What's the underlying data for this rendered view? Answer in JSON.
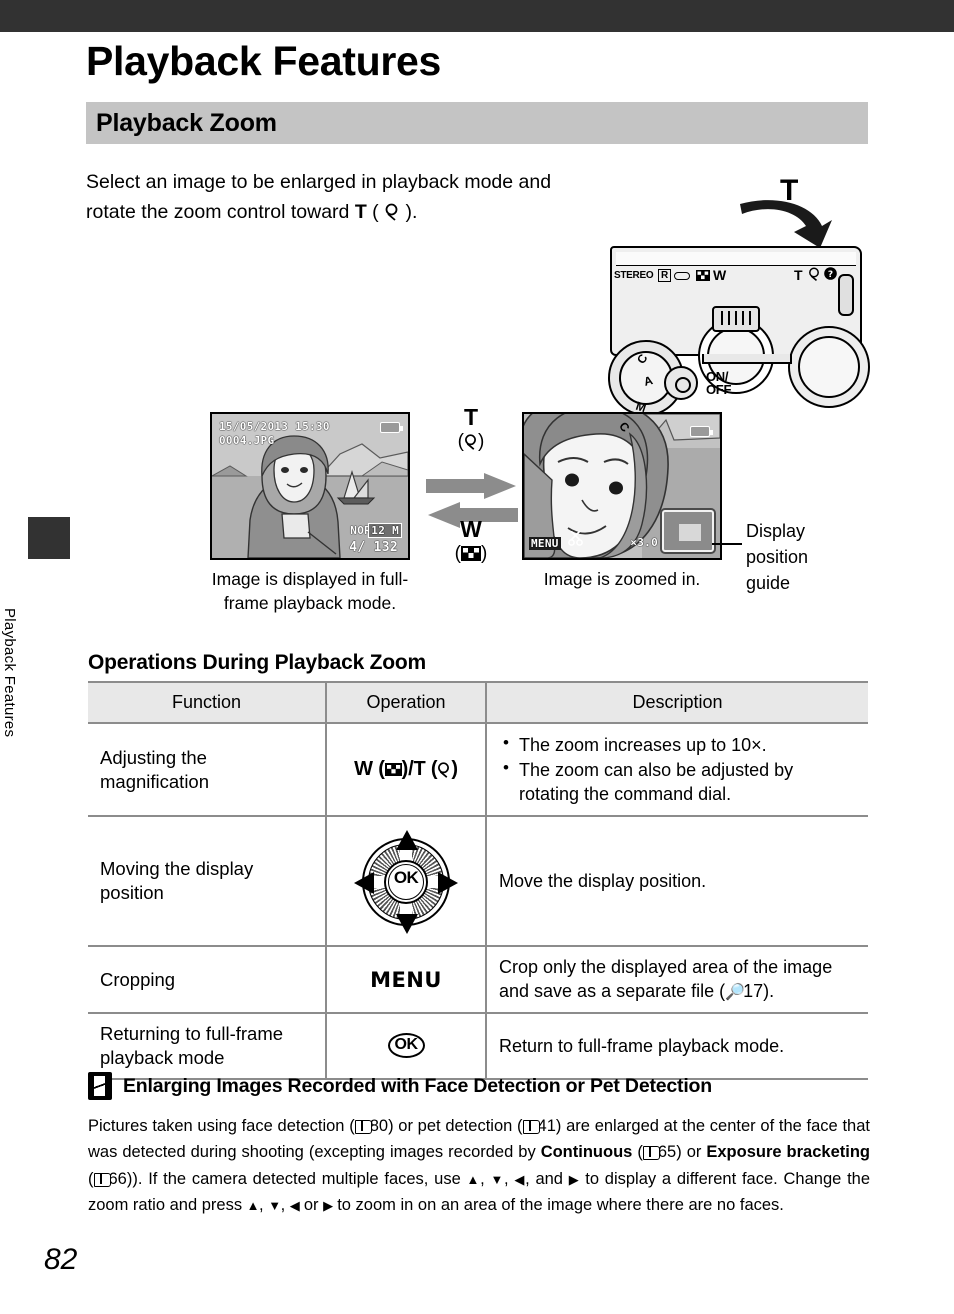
{
  "page": {
    "number": "82",
    "sidebar_vertical_label": "Playback Features",
    "title": "Playback Features",
    "section_band": "Playback Zoom"
  },
  "intro": {
    "line1": "Select an image to be enlarged in playback mode and",
    "line2_pre": "rotate the zoom control toward ",
    "line2_key": "T",
    "line2_post": " (",
    "line2_icon": "magnifier-icon",
    "line2_end": ").",
    "camera_label_T": "T"
  },
  "camera": {
    "labels": {
      "stereo": "STEREO",
      "r_mark": "R",
      "wide": "W",
      "tele": "T",
      "onoff": "ON/\nOFF",
      "mode_m": "M",
      "mode_a": "A",
      "mode_c": "C",
      "thumb_icon": "thumbnail-grid-icon",
      "magnifier_icon": "magnifier-icon",
      "help_icon": "help-question-icon"
    },
    "rotate_arrow": "curved-rotate-arrow-icon"
  },
  "diagram": {
    "lcd_full": {
      "datetime": "15/05/2013  15:30",
      "filename": "0004.JPG",
      "quality": "NORM",
      "size_badge": "12 M",
      "counter": "4/ 132"
    },
    "lcd_zoom": {
      "menu_key": "MENU",
      "crop_icon": "crop-scissors-icon",
      "zoom_ratio": "×3.0",
      "guide_icon": "display-position-guide-icon"
    },
    "tele_label": {
      "key": "T",
      "icon_text": "(Q)"
    },
    "wide_label": {
      "key": "W",
      "icon_text": "(⬚)"
    },
    "caption_left_l1": "Image is displayed in full-",
    "caption_left_l2": "frame playback mode.",
    "caption_right": "Image is zoomed in.",
    "guide_label_l1": "Display",
    "guide_label_l2": "position",
    "guide_label_l3": "guide"
  },
  "operations": {
    "heading": "Operations During Playback Zoom",
    "columns": [
      "Function",
      "Operation",
      "Description"
    ],
    "rows": [
      {
        "function": "Adjusting the\nmagnification",
        "operation_type": "wt-keys",
        "operation_w": "W",
        "operation_t": "T",
        "description_bullets": [
          "The zoom increases up to 10×.",
          "The zoom can also be adjusted by rotating the command dial."
        ]
      },
      {
        "function": "Moving the display\nposition",
        "operation_type": "multi-selector",
        "operation_label": "OK",
        "description": "Move the display position."
      },
      {
        "function": "Cropping",
        "operation_type": "menu-key",
        "operation_label": "MENU",
        "description_pre": "Crop only the displayed area of the image and save as a separate file (",
        "description_ref": "17",
        "description_post": ")."
      },
      {
        "function": "Returning to full-frame\nplayback mode",
        "operation_type": "ok-key",
        "operation_label": "OK",
        "description": "Return to full-frame playback mode."
      }
    ]
  },
  "note": {
    "icon": "pencil-note-icon",
    "title": "Enlarging Images Recorded with Face Detection or Pet Detection",
    "t1": "Pictures taken using face detection (",
    "ref1": "80",
    "t2": ") or pet detection (",
    "ref2": "41",
    "t3": ") are enlarged at the center of the face that was detected during shooting (excepting images recorded by ",
    "b1": "Continuous",
    "t4": " (",
    "ref3": "65",
    "t5": ") or ",
    "b2": "Exposure bracketing",
    "t6": " (",
    "ref4": "66",
    "t7": ")). If the camera detected multiple faces, use ",
    "t8": ", and ",
    "t9": " to display a different face. Change the zoom ratio and press ",
    "t10": " or ",
    "t11": " to zoom in on an area of the image where there are no faces."
  },
  "colors": {
    "header_bar": "#323232",
    "band": "#c4c4c4",
    "table_header": "#e8e8e8",
    "rule": "#8c8c8c",
    "lcd_bg": "#bfbfbf",
    "arrow_gray": "#8c8c8c"
  }
}
